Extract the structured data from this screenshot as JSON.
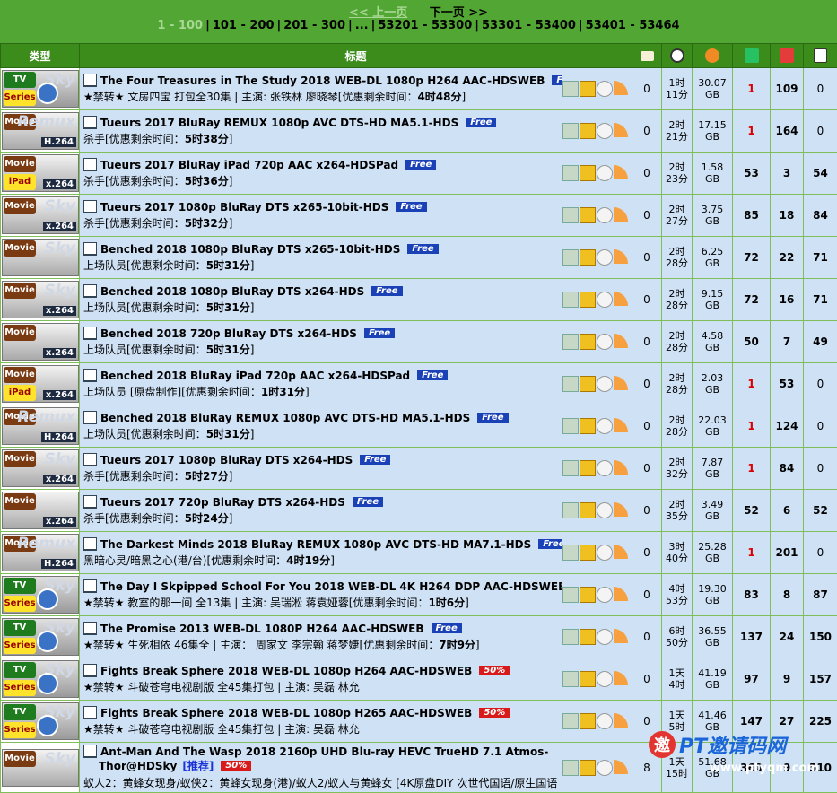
{
  "pager": {
    "prev": "<< 上一页",
    "next": "下一页 >>",
    "pages": [
      "1 - 100",
      "101 - 200",
      "201 - 300",
      "...",
      "53201 - 53300",
      "53301 - 53400",
      "53401 - 53464"
    ]
  },
  "columns": {
    "category": "类型",
    "title": "标题",
    "icons": [
      "comment-icon",
      "clock-icon",
      "size-icon",
      "seeders-icon",
      "leechers-icon",
      "completed-icon"
    ]
  },
  "rows": [
    {
      "cat": "TV",
      "cat2": "Series",
      "logo": "Sky",
      "title": "The Four Treasures in The Study 2018 WEB-DL 1080p H264 AAC-HDSWEB",
      "badge": "Free",
      "badge_type": "free",
      "sub_pre": "★禁转★ 文房四宝 打包全30集 | 主演: 张铁林 廖晓琴[优惠剩余时间：",
      "sub_time": "4时48分",
      "sub_post": "]",
      "comments": "0",
      "time1": "1时",
      "time2": "11分",
      "size1": "30.07",
      "size2": "GB",
      "seed": "1",
      "seed_red": true,
      "leech": "109",
      "done": "0"
    },
    {
      "cat": "Movie",
      "cat2": "",
      "logo": "Remux",
      "codec": "H.264",
      "title": "Tueurs 2017 BluRay REMUX 1080p AVC DTS-HD MA5.1-HDS",
      "badge": "Free",
      "badge_type": "free",
      "sub_pre": "杀手[优惠剩余时间：",
      "sub_time": "5时38分",
      "sub_post": "]",
      "comments": "0",
      "time1": "2时",
      "time2": "21分",
      "size1": "17.15",
      "size2": "GB",
      "seed": "1",
      "seed_red": true,
      "leech": "164",
      "done": "0"
    },
    {
      "cat": "Movie",
      "cat2": "iPad",
      "logo": "",
      "codec": "x.264",
      "title": "Tueurs 2017 BluRay iPad 720p AAC x264-HDSPad",
      "badge": "Free",
      "badge_type": "free",
      "sub_pre": "杀手[优惠剩余时间：",
      "sub_time": "5时36分",
      "sub_post": "]",
      "comments": "0",
      "time1": "2时",
      "time2": "23分",
      "size1": "1.58",
      "size2": "GB",
      "seed": "53",
      "seed_red": false,
      "leech": "3",
      "done": "54"
    },
    {
      "cat": "Movie",
      "cat2": "",
      "logo": "Sky",
      "codec": "x.264",
      "title": "Tueurs 2017 1080p BluRay DTS x265-10bit-HDS",
      "badge": "Free",
      "badge_type": "free",
      "sub_pre": "杀手[优惠剩余时间：",
      "sub_time": "5时32分",
      "sub_post": "]",
      "comments": "0",
      "time1": "2时",
      "time2": "27分",
      "size1": "3.75",
      "size2": "GB",
      "seed": "85",
      "seed_red": false,
      "leech": "18",
      "done": "84"
    },
    {
      "cat": "Movie",
      "cat2": "",
      "logo": "Sky",
      "codec": "",
      "title": "Benched 2018 1080p BluRay DTS x265-10bit-HDS",
      "badge": "Free",
      "badge_type": "free",
      "sub_pre": "上场队员[优惠剩余时间：",
      "sub_time": "5时31分",
      "sub_post": "]",
      "comments": "0",
      "time1": "2时",
      "time2": "28分",
      "size1": "6.25",
      "size2": "GB",
      "seed": "72",
      "seed_red": false,
      "leech": "22",
      "done": "71"
    },
    {
      "cat": "Movie",
      "cat2": "",
      "logo": "Sky",
      "codec": "x.264",
      "title": "Benched 2018 1080p BluRay DTS x264-HDS",
      "badge": "Free",
      "badge_type": "free",
      "sub_pre": "上场队员[优惠剩余时间：",
      "sub_time": "5时31分",
      "sub_post": "]",
      "comments": "0",
      "time1": "2时",
      "time2": "28分",
      "size1": "9.15",
      "size2": "GB",
      "seed": "72",
      "seed_red": false,
      "leech": "16",
      "done": "71"
    },
    {
      "cat": "Movie",
      "cat2": "",
      "logo": "",
      "codec": "x.264",
      "title": "Benched 2018 720p BluRay DTS x264-HDS",
      "badge": "Free",
      "badge_type": "free",
      "sub_pre": "上场队员[优惠剩余时间：",
      "sub_time": "5时31分",
      "sub_post": "]",
      "comments": "0",
      "time1": "2时",
      "time2": "28分",
      "size1": "4.58",
      "size2": "GB",
      "seed": "50",
      "seed_red": false,
      "leech": "7",
      "done": "49"
    },
    {
      "cat": "Movie",
      "cat2": "iPad",
      "logo": "",
      "codec": "x.264",
      "title": "Benched 2018 BluRay iPad 720p AAC x264-HDSPad",
      "badge": "Free",
      "badge_type": "free",
      "sub_pre": "上场队员 [原盘制作][优惠剩余时间：",
      "sub_time": "1时31分",
      "sub_post": "]",
      "comments": "0",
      "time1": "2时",
      "time2": "28分",
      "size1": "2.03",
      "size2": "GB",
      "seed": "1",
      "seed_red": true,
      "leech": "53",
      "done": "0"
    },
    {
      "cat": "Movie",
      "cat2": "",
      "logo": "Remux",
      "codec": "H.264",
      "title": "Benched 2018 BluRay REMUX 1080p AVC DTS-HD MA5.1-HDS",
      "badge": "Free",
      "badge_type": "free",
      "sub_pre": "上场队员[优惠剩余时间：",
      "sub_time": "5时31分",
      "sub_post": "]",
      "comments": "0",
      "time1": "2时",
      "time2": "28分",
      "size1": "22.03",
      "size2": "GB",
      "seed": "1",
      "seed_red": true,
      "leech": "124",
      "done": "0"
    },
    {
      "cat": "Movie",
      "cat2": "",
      "logo": "Sky",
      "codec": "x.264",
      "title": "Tueurs 2017 1080p BluRay DTS x264-HDS",
      "badge": "Free",
      "badge_type": "free",
      "sub_pre": "杀手[优惠剩余时间：",
      "sub_time": "5时27分",
      "sub_post": "]",
      "comments": "0",
      "time1": "2时",
      "time2": "32分",
      "size1": "7.87",
      "size2": "GB",
      "seed": "1",
      "seed_red": true,
      "leech": "84",
      "done": "0"
    },
    {
      "cat": "Movie",
      "cat2": "",
      "logo": "",
      "codec": "x.264",
      "title": "Tueurs 2017 720p BluRay DTS x264-HDS",
      "badge": "Free",
      "badge_type": "free",
      "sub_pre": "杀手[优惠剩余时间：",
      "sub_time": "5时24分",
      "sub_post": "]",
      "comments": "0",
      "time1": "2时",
      "time2": "35分",
      "size1": "3.49",
      "size2": "GB",
      "seed": "52",
      "seed_red": false,
      "leech": "6",
      "done": "52"
    },
    {
      "cat": "Movie",
      "cat2": "",
      "logo": "Remux",
      "codec": "H.264",
      "title": "The Darkest Minds 2018 BluRay REMUX 1080p AVC DTS-HD MA7.1-HDS",
      "badge": "Free",
      "badge_type": "free",
      "sub_pre": "黑暗心灵/暗黑之心(港/台)[优惠剩余时间：",
      "sub_time": "4时19分",
      "sub_post": "]",
      "comments": "0",
      "time1": "3时",
      "time2": "40分",
      "size1": "25.28",
      "size2": "GB",
      "seed": "1",
      "seed_red": true,
      "leech": "201",
      "done": "0"
    },
    {
      "cat": "TV",
      "cat2": "Series",
      "logo": "Sky",
      "title": "The Day I Skpipped School For You 2018 WEB-DL 4K H264 DDP AAC-HDSWEB",
      "badge": "Free",
      "badge_type": "free",
      "sub_pre": "★禁转★ 教室的那一间 全13集 | 主演: 吴瑞淞 蒋袁娅蓉[优惠剩余时间：",
      "sub_time": "1时6分",
      "sub_post": "]",
      "comments": "0",
      "time1": "4时",
      "time2": "53分",
      "size1": "19.30",
      "size2": "GB",
      "seed": "83",
      "seed_red": false,
      "leech": "8",
      "done": "87"
    },
    {
      "cat": "TV",
      "cat2": "Series",
      "logo": "Sky",
      "title": "The Promise 2013 WEB-DL 1080P H264 AAC-HDSWEB",
      "badge": "Free",
      "badge_type": "free",
      "sub_pre": "★禁转★ 生死相依 46集全 | 主演： 周家文 李宗翰 蒋梦婕[优惠剩余时间：",
      "sub_time": "7时9分",
      "sub_post": "]",
      "comments": "0",
      "time1": "6时",
      "time2": "50分",
      "size1": "36.55",
      "size2": "GB",
      "seed": "137",
      "seed_red": false,
      "leech": "24",
      "done": "150"
    },
    {
      "cat": "TV",
      "cat2": "Series",
      "logo": "Sky",
      "title": "Fights Break Sphere 2018 WEB-DL 1080p H264 AAC-HDSWEB",
      "badge": "50%",
      "badge_type": "pct",
      "sub_pre": "★禁转★ 斗破苍穹电视剧版 全45集打包 | 主演: 吴磊 林允",
      "sub_time": "",
      "sub_post": "",
      "comments": "0",
      "time1": "1天",
      "time2": "4时",
      "size1": "41.19",
      "size2": "GB",
      "seed": "97",
      "seed_red": false,
      "leech": "9",
      "done": "157"
    },
    {
      "cat": "TV",
      "cat2": "Series",
      "logo": "Sky",
      "title": "Fights Break Sphere 2018 WEB-DL 1080p H265 AAC-HDSWEB",
      "badge": "50%",
      "badge_type": "pct",
      "sub_pre": "★禁转★ 斗破苍穹电视剧版 全45集打包 | 主演: 吴磊 林允",
      "sub_time": "",
      "sub_post": "",
      "comments": "0",
      "time1": "1天",
      "time2": "5时",
      "size1": "41.46",
      "size2": "GB",
      "seed": "147",
      "seed_red": false,
      "leech": "27",
      "done": "225"
    },
    {
      "cat": "Movie",
      "cat2": "",
      "logo": "Sky",
      "codec": "",
      "title": "Ant-Man And The Wasp 2018 2160p UHD Blu-ray HEVC TrueHD 7.1 Atmos-",
      "title2": "Thor@HDSky",
      "rec": "[推荐]",
      "badge": "50%",
      "badge_type": "pct",
      "sub_pre": "蚁人2：黄蜂女现身/蚁侠2：黄蜂女现身(港)/蚁人2/蚁人与黄蜂女 [4K原盘DIY 次世代国语/原生国语",
      "sub_time": "",
      "sub_post": "",
      "comments": "8",
      "time1": "1天",
      "time2": "15时",
      "size1": "51.68",
      "size2": "GB",
      "seed": "360",
      "seed_red": false,
      "leech": "9",
      "done": "510"
    }
  ],
  "watermark": {
    "logo_letter": "邀",
    "text": "PT邀请码网",
    "url": "www.ptyqm.com"
  },
  "colors": {
    "header_bar": "#3c8c1c",
    "pager_bg": "#52a633",
    "row_bg": "#cfe1f5",
    "free_badge": "#1a41b6",
    "pct_badge": "#d81a1a",
    "seed_red": "#d80000"
  }
}
